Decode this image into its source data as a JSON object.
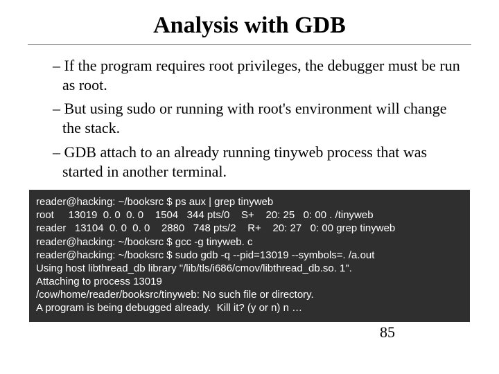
{
  "title": "Analysis with GDB",
  "bullets": [
    "If the program requires root privileges, the debugger must be run as root.",
    "But using sudo or running with root's environment will change the stack.",
    "GDB attach to an already running tinyweb process that was started in  another terminal."
  ],
  "terminal": [
    "reader@hacking: ~/booksrc $ ps aux | grep tinyweb",
    "root     13019  0. 0  0. 0    1504   344 pts/0    S+    20: 25   0: 00 . /tinyweb",
    "reader   13104  0. 0  0. 0    2880   748 pts/2    R+    20: 27   0: 00 grep tinyweb",
    "reader@hacking: ~/booksrc $ gcc -g tinyweb. c",
    "reader@hacking: ~/booksrc $ sudo gdb -q --pid=13019 --symbols=. /a.out",
    "Using host libthread_db library \"/lib/tls/i686/cmov/libthread_db.so. 1\".",
    "Attaching to process 13019",
    "/cow/home/reader/booksrc/tinyweb: No such file or directory.",
    "A program is being debugged already.  Kill it? (y or n) n …"
  ],
  "pagenum": "85",
  "dash": "– "
}
